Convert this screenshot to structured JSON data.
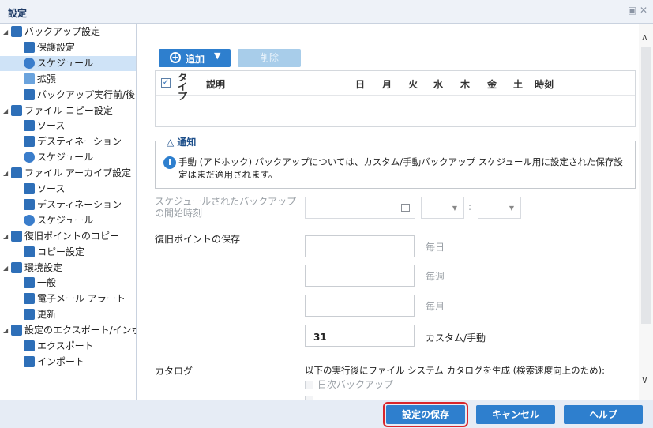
{
  "window": {
    "title": "設定",
    "restore_icon": "▣",
    "close_icon": "✕"
  },
  "tree": {
    "items": [
      {
        "label": "バックアップ設定",
        "level": 0,
        "expanded": true,
        "icon": "backup-icon"
      },
      {
        "label": "保護設定",
        "level": 1,
        "icon": "protection-icon"
      },
      {
        "label": "スケジュール",
        "level": 1,
        "icon": "schedule-icon",
        "selected": true
      },
      {
        "label": "拡張",
        "level": 1,
        "icon": "advanced-icon"
      },
      {
        "label": "バックアップ実行前/後の設",
        "level": 1,
        "icon": "wrench-icon"
      },
      {
        "label": "ファイル コピー設定",
        "level": 0,
        "expanded": true,
        "icon": "file-copy-icon"
      },
      {
        "label": "ソース",
        "level": 1,
        "icon": "source-icon"
      },
      {
        "label": "デスティネーション",
        "level": 1,
        "icon": "destination-icon"
      },
      {
        "label": "スケジュール",
        "level": 1,
        "icon": "schedule-icon"
      },
      {
        "label": "ファイル アーカイブ設定",
        "level": 0,
        "expanded": true,
        "icon": "file-archive-icon"
      },
      {
        "label": "ソース",
        "level": 1,
        "icon": "source-icon"
      },
      {
        "label": "デスティネーション",
        "level": 1,
        "icon": "destination-icon"
      },
      {
        "label": "スケジュール",
        "level": 1,
        "icon": "schedule-icon"
      },
      {
        "label": "復旧ポイントのコピー",
        "level": 0,
        "expanded": true,
        "icon": "recovery-copy-icon"
      },
      {
        "label": "コピー設定",
        "level": 1,
        "icon": "copy-settings-icon"
      },
      {
        "label": "環境設定",
        "level": 0,
        "expanded": true,
        "icon": "preferences-icon"
      },
      {
        "label": "一般",
        "level": 1,
        "icon": "general-icon"
      },
      {
        "label": "電子メール アラート",
        "level": 1,
        "icon": "email-icon"
      },
      {
        "label": "更新",
        "level": 1,
        "icon": "update-icon"
      },
      {
        "label": "設定のエクスポート/インポート",
        "level": 0,
        "expanded": true,
        "icon": "export-import-icon"
      },
      {
        "label": "エクスポート",
        "level": 1,
        "icon": "export-icon"
      },
      {
        "label": "インポート",
        "level": 1,
        "icon": "import-icon"
      }
    ],
    "scroll_left": "<",
    "scroll_right": ">"
  },
  "toolbar": {
    "add_label": "追加",
    "delete_label": "削除"
  },
  "schedule_grid": {
    "headers": [
      "タイプ",
      "説明",
      "日",
      "月",
      "火",
      "水",
      "木",
      "金",
      "土",
      "時刻"
    ]
  },
  "notice": {
    "legend": "通知",
    "message": "手動 (アドホック) バックアップについては、カスタム/手動バックアップ スケジュール用に設定された保存設定はまだ適用されます。"
  },
  "start_time": {
    "label": "スケジュールされたバックアップの開始時刻",
    "separator": ":"
  },
  "retention": {
    "title": "復旧ポイントの保存",
    "daily_label": "毎日",
    "weekly_label": "毎週",
    "monthly_label": "毎月",
    "custom_label": "カスタム/手動",
    "daily_value": "",
    "weekly_value": "",
    "monthly_value": "",
    "custom_value": "31"
  },
  "catalog": {
    "title": "カタログ",
    "description": "以下の実行後にファイル システム カタログを生成 (検索速度向上のため):",
    "daily_backup": "日次バックアップ"
  },
  "footer": {
    "save_label": "設定の保存",
    "cancel_label": "キャンセル",
    "help_label": "ヘルプ"
  },
  "colors": {
    "accent": "#2e7fce",
    "focus_outline": "#d9262c",
    "selected_row": "#cfe3f7"
  }
}
